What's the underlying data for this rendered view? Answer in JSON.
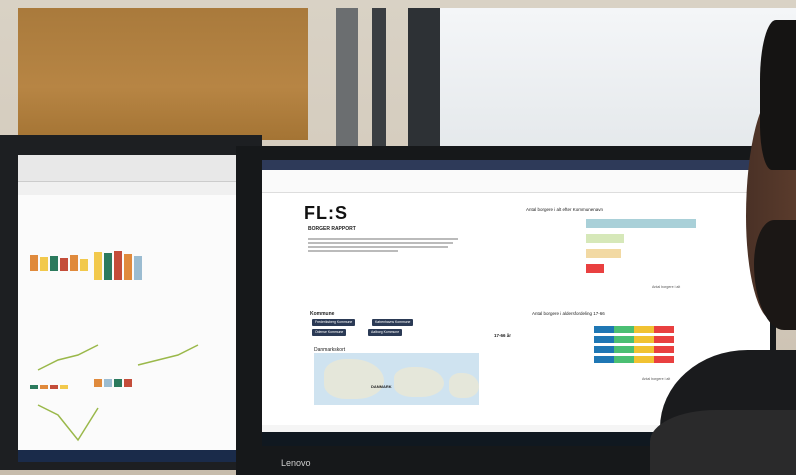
{
  "photo": {
    "report": {
      "logo": "FL:S",
      "title": "BORGER RAPPORT",
      "chart_title": "Antal borgere i alt efter Kommunenavn",
      "chart2_title": "Antal borgere i aldersfordeling 17-66",
      "filter_label": "Kommune",
      "map_label": "Danmarkskort",
      "age_label": "17-66 år",
      "xaxis_label": "Antal borgere i alt",
      "selected_municipalities": [
        "Frederiksberg Kommune",
        "Københavns Kommune",
        "Odense Kommune",
        "Aalborg Kommune"
      ],
      "map_country": "DANMARK"
    },
    "monitor_brand": "Lenovo"
  }
}
